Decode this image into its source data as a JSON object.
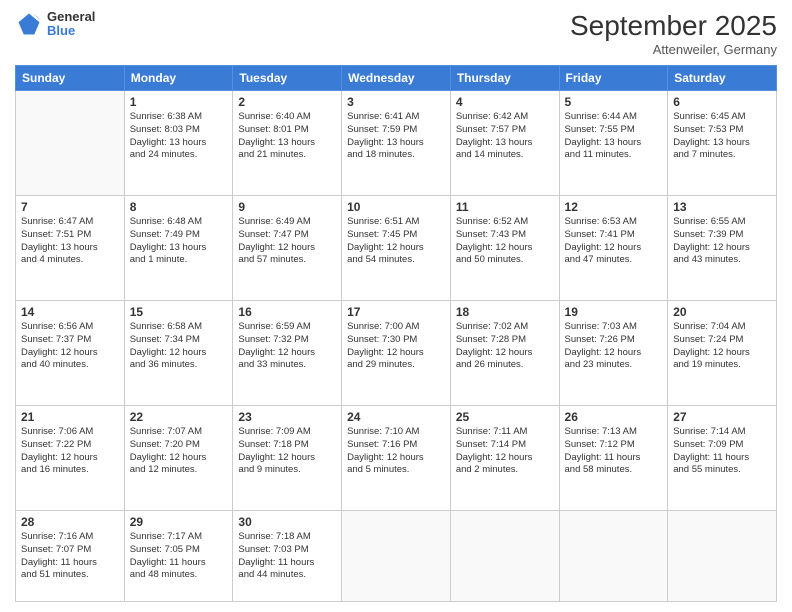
{
  "header": {
    "logo": {
      "general": "General",
      "blue": "Blue"
    },
    "title": "September 2025",
    "location": "Attenweiler, Germany"
  },
  "days_of_week": [
    "Sunday",
    "Monday",
    "Tuesday",
    "Wednesday",
    "Thursday",
    "Friday",
    "Saturday"
  ],
  "weeks": [
    [
      {
        "day": "",
        "info": ""
      },
      {
        "day": "1",
        "info": "Sunrise: 6:38 AM\nSunset: 8:03 PM\nDaylight: 13 hours\nand 24 minutes."
      },
      {
        "day": "2",
        "info": "Sunrise: 6:40 AM\nSunset: 8:01 PM\nDaylight: 13 hours\nand 21 minutes."
      },
      {
        "day": "3",
        "info": "Sunrise: 6:41 AM\nSunset: 7:59 PM\nDaylight: 13 hours\nand 18 minutes."
      },
      {
        "day": "4",
        "info": "Sunrise: 6:42 AM\nSunset: 7:57 PM\nDaylight: 13 hours\nand 14 minutes."
      },
      {
        "day": "5",
        "info": "Sunrise: 6:44 AM\nSunset: 7:55 PM\nDaylight: 13 hours\nand 11 minutes."
      },
      {
        "day": "6",
        "info": "Sunrise: 6:45 AM\nSunset: 7:53 PM\nDaylight: 13 hours\nand 7 minutes."
      }
    ],
    [
      {
        "day": "7",
        "info": "Sunrise: 6:47 AM\nSunset: 7:51 PM\nDaylight: 13 hours\nand 4 minutes."
      },
      {
        "day": "8",
        "info": "Sunrise: 6:48 AM\nSunset: 7:49 PM\nDaylight: 13 hours\nand 1 minute."
      },
      {
        "day": "9",
        "info": "Sunrise: 6:49 AM\nSunset: 7:47 PM\nDaylight: 12 hours\nand 57 minutes."
      },
      {
        "day": "10",
        "info": "Sunrise: 6:51 AM\nSunset: 7:45 PM\nDaylight: 12 hours\nand 54 minutes."
      },
      {
        "day": "11",
        "info": "Sunrise: 6:52 AM\nSunset: 7:43 PM\nDaylight: 12 hours\nand 50 minutes."
      },
      {
        "day": "12",
        "info": "Sunrise: 6:53 AM\nSunset: 7:41 PM\nDaylight: 12 hours\nand 47 minutes."
      },
      {
        "day": "13",
        "info": "Sunrise: 6:55 AM\nSunset: 7:39 PM\nDaylight: 12 hours\nand 43 minutes."
      }
    ],
    [
      {
        "day": "14",
        "info": "Sunrise: 6:56 AM\nSunset: 7:37 PM\nDaylight: 12 hours\nand 40 minutes."
      },
      {
        "day": "15",
        "info": "Sunrise: 6:58 AM\nSunset: 7:34 PM\nDaylight: 12 hours\nand 36 minutes."
      },
      {
        "day": "16",
        "info": "Sunrise: 6:59 AM\nSunset: 7:32 PM\nDaylight: 12 hours\nand 33 minutes."
      },
      {
        "day": "17",
        "info": "Sunrise: 7:00 AM\nSunset: 7:30 PM\nDaylight: 12 hours\nand 29 minutes."
      },
      {
        "day": "18",
        "info": "Sunrise: 7:02 AM\nSunset: 7:28 PM\nDaylight: 12 hours\nand 26 minutes."
      },
      {
        "day": "19",
        "info": "Sunrise: 7:03 AM\nSunset: 7:26 PM\nDaylight: 12 hours\nand 23 minutes."
      },
      {
        "day": "20",
        "info": "Sunrise: 7:04 AM\nSunset: 7:24 PM\nDaylight: 12 hours\nand 19 minutes."
      }
    ],
    [
      {
        "day": "21",
        "info": "Sunrise: 7:06 AM\nSunset: 7:22 PM\nDaylight: 12 hours\nand 16 minutes."
      },
      {
        "day": "22",
        "info": "Sunrise: 7:07 AM\nSunset: 7:20 PM\nDaylight: 12 hours\nand 12 minutes."
      },
      {
        "day": "23",
        "info": "Sunrise: 7:09 AM\nSunset: 7:18 PM\nDaylight: 12 hours\nand 9 minutes."
      },
      {
        "day": "24",
        "info": "Sunrise: 7:10 AM\nSunset: 7:16 PM\nDaylight: 12 hours\nand 5 minutes."
      },
      {
        "day": "25",
        "info": "Sunrise: 7:11 AM\nSunset: 7:14 PM\nDaylight: 12 hours\nand 2 minutes."
      },
      {
        "day": "26",
        "info": "Sunrise: 7:13 AM\nSunset: 7:12 PM\nDaylight: 11 hours\nand 58 minutes."
      },
      {
        "day": "27",
        "info": "Sunrise: 7:14 AM\nSunset: 7:09 PM\nDaylight: 11 hours\nand 55 minutes."
      }
    ],
    [
      {
        "day": "28",
        "info": "Sunrise: 7:16 AM\nSunset: 7:07 PM\nDaylight: 11 hours\nand 51 minutes."
      },
      {
        "day": "29",
        "info": "Sunrise: 7:17 AM\nSunset: 7:05 PM\nDaylight: 11 hours\nand 48 minutes."
      },
      {
        "day": "30",
        "info": "Sunrise: 7:18 AM\nSunset: 7:03 PM\nDaylight: 11 hours\nand 44 minutes."
      },
      {
        "day": "",
        "info": ""
      },
      {
        "day": "",
        "info": ""
      },
      {
        "day": "",
        "info": ""
      },
      {
        "day": "",
        "info": ""
      }
    ]
  ]
}
